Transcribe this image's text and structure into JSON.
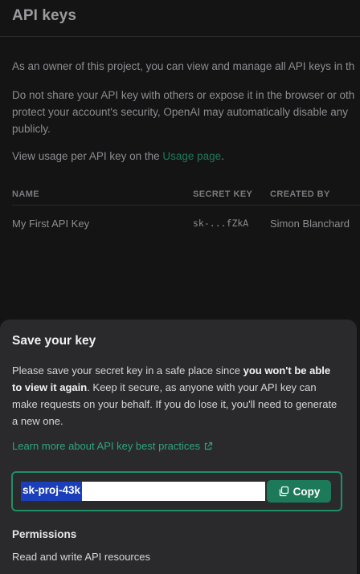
{
  "header": {
    "title": "API keys"
  },
  "intro": {
    "owner_text": "As an owner of this project, you can view and manage all API keys in th",
    "share_warning_line1": "Do not share your API key with others or expose it in the browser or oth",
    "share_warning_line2": "protect your account's security, OpenAI may automatically disable any",
    "share_warning_line3": "publicly.",
    "usage_prefix": "View usage per API key on the ",
    "usage_link": "Usage page",
    "usage_suffix": "."
  },
  "table": {
    "columns": [
      "NAME",
      "SECRET KEY",
      "CREATED BY"
    ],
    "rows": [
      {
        "name": "My First API Key",
        "secret_key": "sk-...fZkA",
        "created_by": "Simon Blanchard"
      }
    ]
  },
  "modal": {
    "title": "Save your key",
    "text_part1": "Please save your secret key in a safe place since ",
    "text_bold": "you won't be able to view it again",
    "text_part2": ". Keep it secure, as anyone with your API key can make requests on your behalf. If you do lose it, you'll need to generate a new one.",
    "learn_link": "Learn more about API key best practices",
    "key_value": "sk-proj-43k",
    "copy_label": "Copy",
    "permissions_title": "Permissions",
    "permissions_value": "Read and write API resources"
  },
  "colors": {
    "accent": "#1c7a5a",
    "background": "#141414",
    "modal_background": "#2a2a2c",
    "selection": "#1a3fb8"
  },
  "icons": {
    "external_link": "external-link-icon",
    "copy": "copy-icon"
  }
}
